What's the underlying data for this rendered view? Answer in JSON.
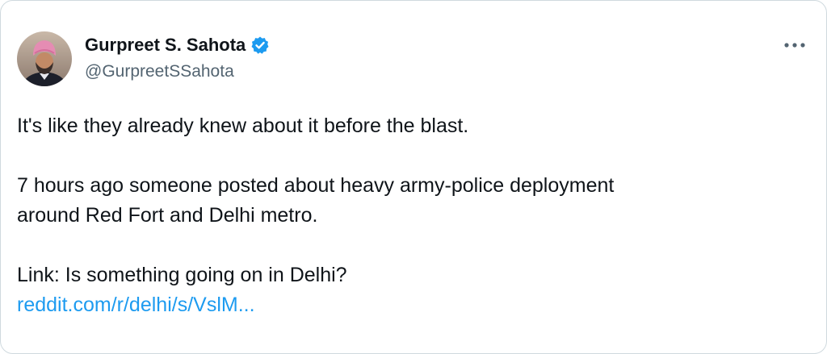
{
  "author": {
    "display_name": "Gurpreet S. Sahota",
    "handle": "@GurpreetSSahota",
    "verified": true
  },
  "menu": {
    "icon": "more-options-icon"
  },
  "tweet": {
    "line1": "It's like they already knew about it before the blast.",
    "line2": "7 hours ago someone posted about heavy army-police deployment",
    "line3": "around Red Fort and Delhi metro.",
    "line4": "Link: Is something going on in Delhi?",
    "link_text": "reddit.com/r/delhi/s/VslM..."
  },
  "colors": {
    "text": "#0f1419",
    "secondary": "#536471",
    "link": "#1d9bf0",
    "verified_badge": "#1d9bf0"
  }
}
